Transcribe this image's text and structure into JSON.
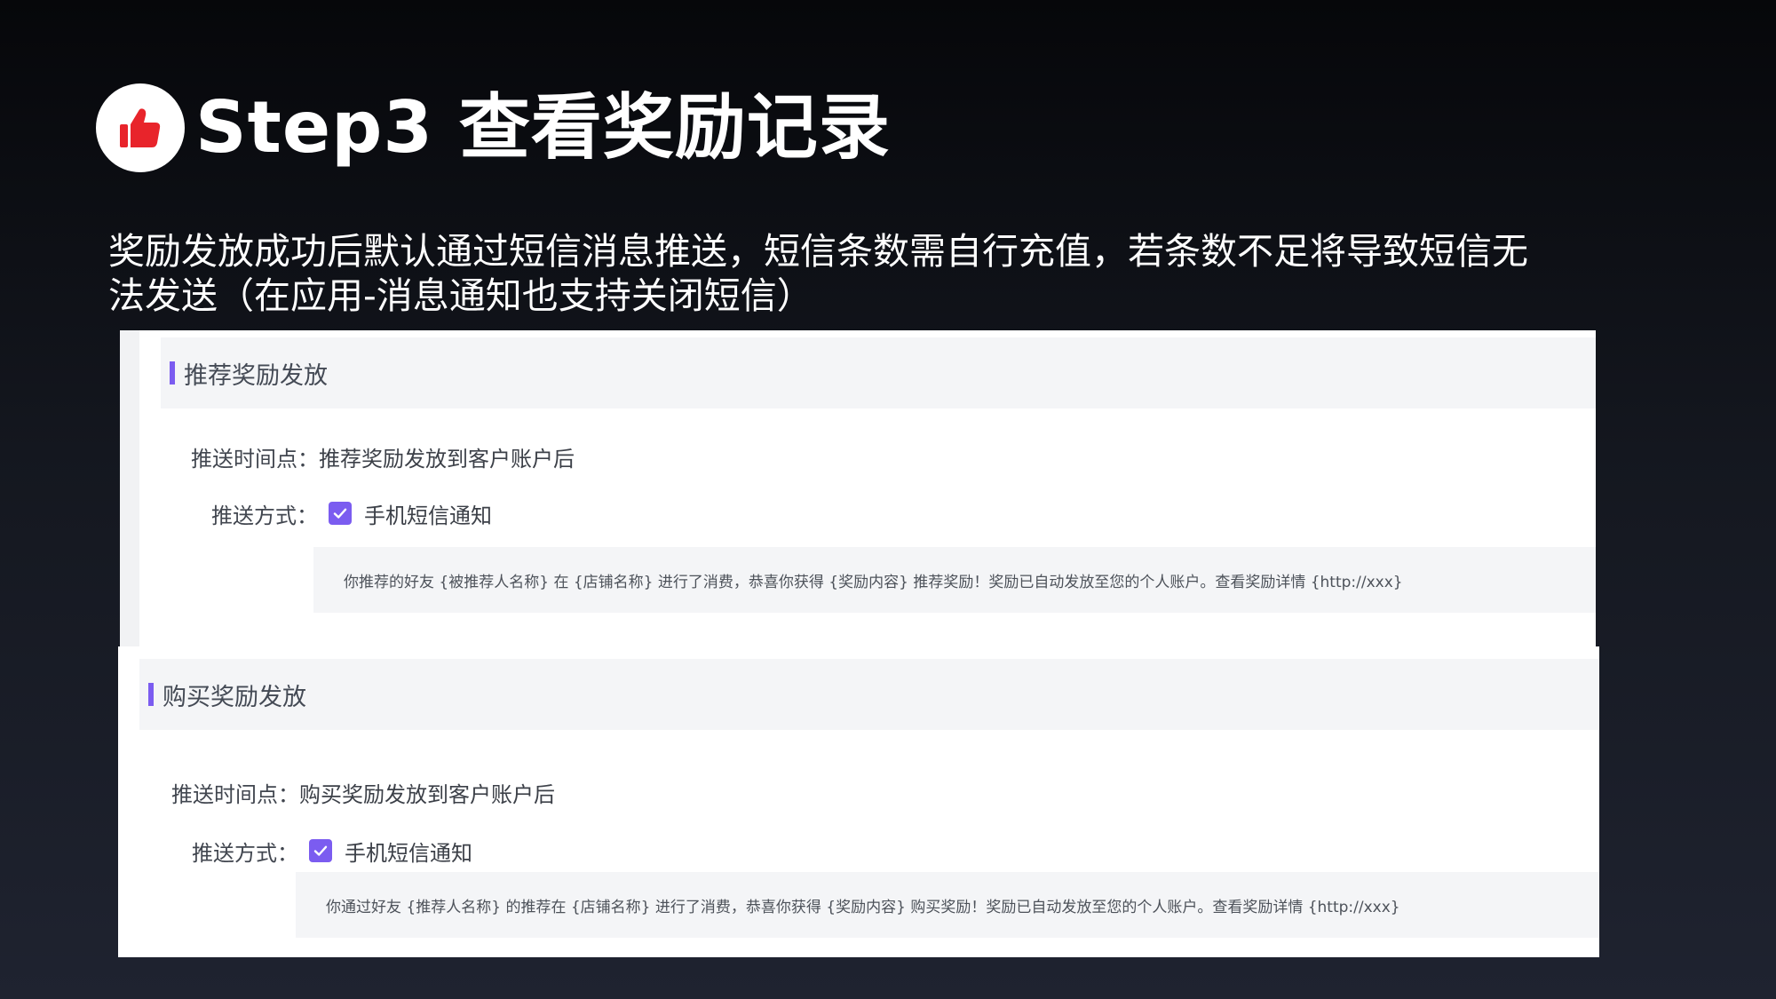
{
  "slide": {
    "title": "Step3 查看奖励记录",
    "description_lines": [
      "奖励发放成功后默认通过短信消息推送，短信条数需自行充值，若条数不足将导致短信无",
      "法发送（在应用-消息通知也支持关闭短信）"
    ],
    "badge_icon": "thumbs-up-icon",
    "badge_icon_color": "#e8242b"
  },
  "sections": [
    {
      "title": "推荐奖励发放",
      "push_time_label": "推送时间点：",
      "push_time_value": "推荐奖励发放到客户账户后",
      "push_method_label": "推送方式：",
      "push_method_option": "手机短信通知",
      "push_method_checked": true,
      "message": "你推荐的好友 {被推荐人名称} 在 {店铺名称} 进行了消费，恭喜你获得 {奖励内容} 推荐奖励！奖励已自动发放至您的个人账户。查看奖励详情 {http://xxx}"
    },
    {
      "title": "购买奖励发放",
      "push_time_label": "推送时间点：",
      "push_time_value": "购买奖励发放到客户账户后",
      "push_method_label": "推送方式：",
      "push_method_option": "手机短信通知",
      "push_method_checked": true,
      "message": "你通过好友 {推荐人名称} 的推荐在 {店铺名称} 进行了消费，恭喜你获得 {奖励内容} 购买奖励！奖励已自动发放至您的个人账户。查看奖励详情 {http://xxx}"
    }
  ],
  "colors": {
    "accent": "#7b5cf0",
    "badge_red": "#e8242b"
  }
}
